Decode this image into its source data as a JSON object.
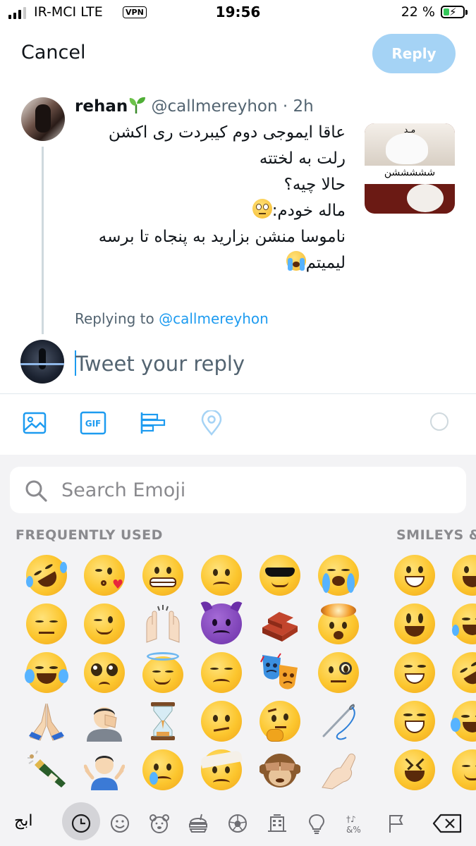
{
  "status_bar": {
    "carrier": "IR-MCI  LTE",
    "vpn": "VPN",
    "time": "19:56",
    "battery": "22 %",
    "battery_level": 0.22,
    "battery_color": "#34c759"
  },
  "header": {
    "cancel_label": "Cancel",
    "reply_label": "Reply",
    "reply_color": "#a5d3f5"
  },
  "tweet": {
    "name": "rehan",
    "name_emoji": "seedling-icon",
    "handle": "@callmereyhon",
    "time": "· 2h",
    "lines": [
      "عاقا ایموجی دوم کیبردت ری اکشن",
      "رلت به لختته",
      "حالا چیه؟",
      "ماله خودم:",
      " ناموسا منشن بزارید به پنجاه تا برسه",
      "لیمیتم"
    ],
    "line_emojis": [
      "eye-roll-emoji",
      "loudly-crying-emoji"
    ],
    "media_text_top": "مـد",
    "media_text_mid": "شششششن"
  },
  "reply": {
    "replying_prefix": "Replying to",
    "replying_handle": "@callmereyhon",
    "placeholder": "Tweet your reply"
  },
  "toolbar": {
    "icons": [
      "image-icon",
      "gif-icon",
      "poll-icon",
      "location-icon",
      "character-count-icon"
    ],
    "accent": "#1d9bf0"
  },
  "emoji_keyboard": {
    "search_placeholder": "Search Emoji",
    "section_frequent": "FREQUENTLY USED",
    "section_smileys": "SMILEYS &",
    "frequent_grid": [
      [
        "rolling-on-floor-laughing",
        "kissing-heart",
        "grimacing",
        "worried",
        "sunglasses",
        "loudly-crying"
      ],
      [
        "pensive",
        "winking",
        "raised-hands",
        "angry-devil",
        "bricks",
        "exploding-head"
      ],
      [
        "tears-of-joy",
        "pleading",
        "halo",
        "disappointed",
        "performing-arts",
        "monocle"
      ],
      [
        "folded-hands",
        "facepalm",
        "hourglass",
        "confused",
        "thinking",
        "sewing-needle"
      ],
      [
        "bottle-popping",
        "shrugging",
        "crying",
        "bandage-head",
        "see-no-evil-monkey",
        "pinched-fingers"
      ]
    ],
    "smileys_grid": [
      [
        "grinning",
        "grinning-big"
      ],
      [
        "smiley",
        "grin-sweat"
      ],
      [
        "beaming",
        "rolling-on-floor-laughing"
      ],
      [
        "grinning-squint",
        "tears-of-joy"
      ],
      [
        "laughing",
        "relieved"
      ]
    ],
    "categories": {
      "abc_label": "ابج",
      "items": [
        "recents-clock-icon",
        "smileys-icon",
        "animals-icon",
        "food-icon",
        "activity-icon",
        "travel-icon",
        "objects-icon",
        "symbols-icon",
        "flags-icon",
        "delete-icon"
      ]
    }
  }
}
